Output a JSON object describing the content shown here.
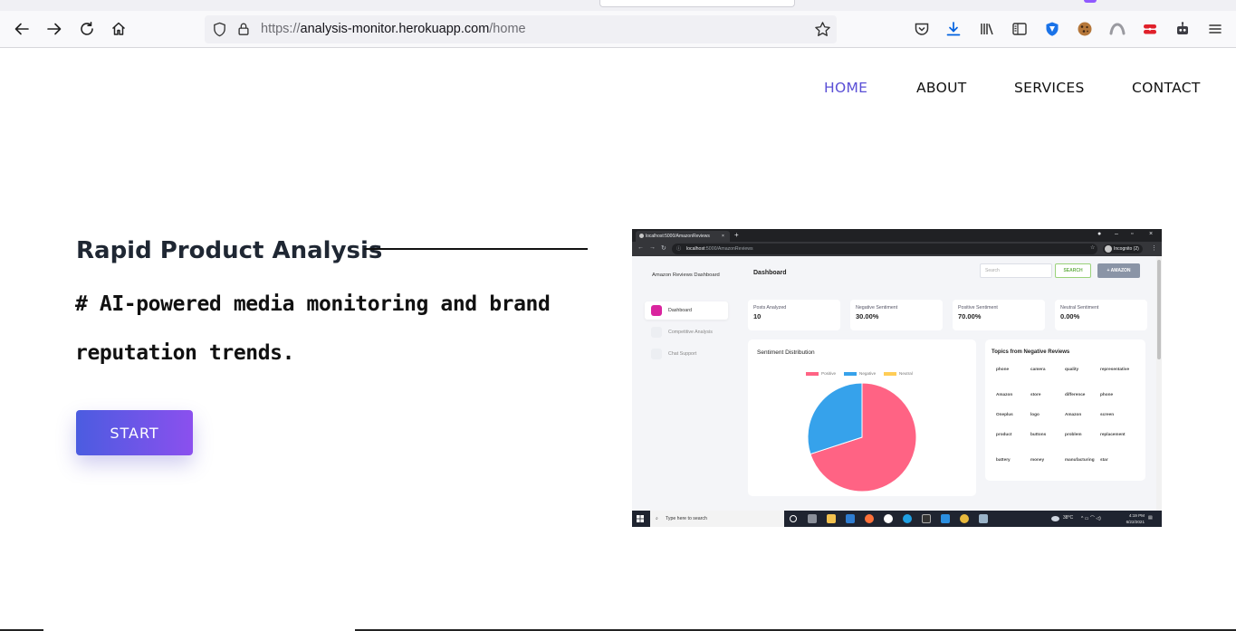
{
  "browser": {
    "url_scheme": "https://",
    "url_host": "analysis-monitor.herokuapp.com",
    "url_path": "/home",
    "icons": [
      "back-icon",
      "forward-icon",
      "reload-icon",
      "home-icon",
      "shield-icon",
      "lock-icon",
      "bookmark-star-icon",
      "pocket-icon",
      "download-icon",
      "library-icon",
      "sidebar-icon",
      "vpn-extension-icon",
      "cookie-extension-icon",
      "firefox-account-icon",
      "extension-red-icon",
      "robot-extension-icon",
      "menu-icon"
    ]
  },
  "nav": {
    "home": "HOME",
    "about": "ABOUT",
    "services": "SERVICES",
    "contact": "CONTACT",
    "active_color": "#5a4fd6"
  },
  "hero": {
    "title": "Rapid Product Analysis",
    "subtitle_line1": "# AI-powered media monitoring and brand",
    "subtitle_line2": "reputation trends.",
    "start_label": "START",
    "button_gradient": [
      "#4b5ce0",
      "#8b50ee"
    ]
  },
  "screenshot": {
    "tab_label": "localhost:5000/AmazonReviews",
    "address_host": "localhost",
    "address_rest": ":5000/AmazonReviews",
    "incognito_label": "Incognito (2)",
    "sidebar_title": "Amazon Reviews Dashboard",
    "page_title": "Dashboard",
    "search_placeholder": "Search",
    "search_button": "SEARCH",
    "amazon_button": "+ AMAZON",
    "menu": [
      {
        "label": "Dashboard",
        "active": true
      },
      {
        "label": "Competitive Analysis",
        "active": false
      },
      {
        "label": "Chat Support",
        "active": false
      }
    ],
    "stats": [
      {
        "label": "Posts Analyzed",
        "value": "10"
      },
      {
        "label": "Negative Sentiment",
        "value": "30.00%"
      },
      {
        "label": "Positive Sentiment",
        "value": "70.00%"
      },
      {
        "label": "Neutral Sentiment",
        "value": "0.00%"
      }
    ],
    "pie_title": "Sentiment Distribution",
    "pie_legend": [
      {
        "label": "Positive",
        "color": "#ff6384"
      },
      {
        "label": "Negative",
        "color": "#36a2eb"
      },
      {
        "label": "Neutral",
        "color": "#ffcd56"
      }
    ],
    "pie_values": [
      70,
      30,
      0
    ],
    "topics_title": "Topics from Negative Reviews",
    "topics": [
      [
        "phone",
        "camera",
        "quality",
        "representative"
      ],
      [
        "Amazon",
        "store",
        "difference",
        "phone"
      ],
      [
        "Oneplus",
        "logo",
        "Amazon",
        "screen"
      ],
      [
        "product",
        "buttons",
        "problem",
        "replacement"
      ],
      [
        "battery",
        "money",
        "manufacturing",
        "star"
      ]
    ],
    "taskbar_search": "Type here to search",
    "tray_temp": "38°C",
    "tray_time": "4:19 PM",
    "tray_date": "6/22/2021"
  }
}
